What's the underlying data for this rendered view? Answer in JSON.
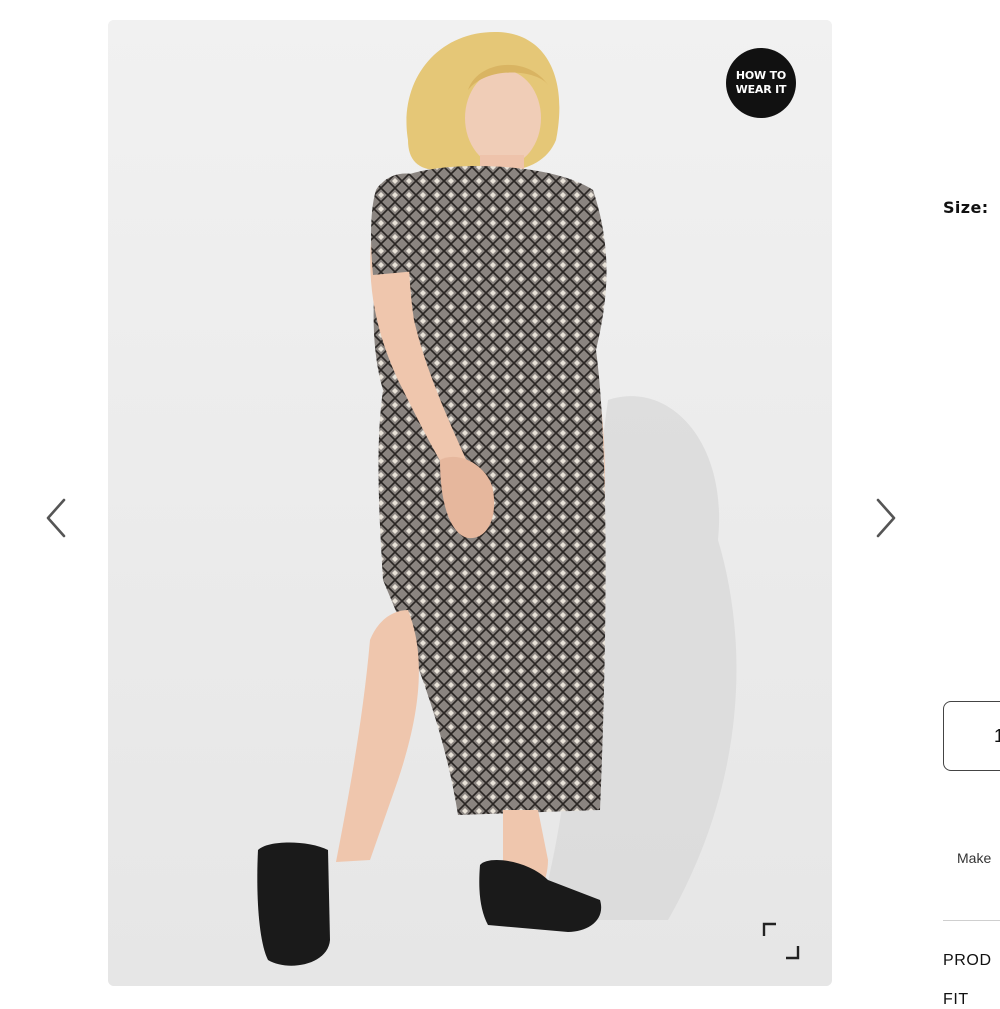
{
  "gallery": {
    "badge_line1": "HOW TO",
    "badge_line2": "WEAR IT",
    "icons": {
      "prev": "chevron-left-icon",
      "next": "chevron-right-icon",
      "expand": "expand-icon"
    }
  },
  "product": {
    "size_label": "Size:",
    "quantity_value": "1",
    "make_text": "Make",
    "section_product": "PROD",
    "section_fit": "FIT"
  },
  "colors": {
    "gallery_bg": "#eeeeee",
    "badge_bg": "#111111",
    "dress_pattern": "#6b6560",
    "sandal": "#1a1a1a"
  }
}
